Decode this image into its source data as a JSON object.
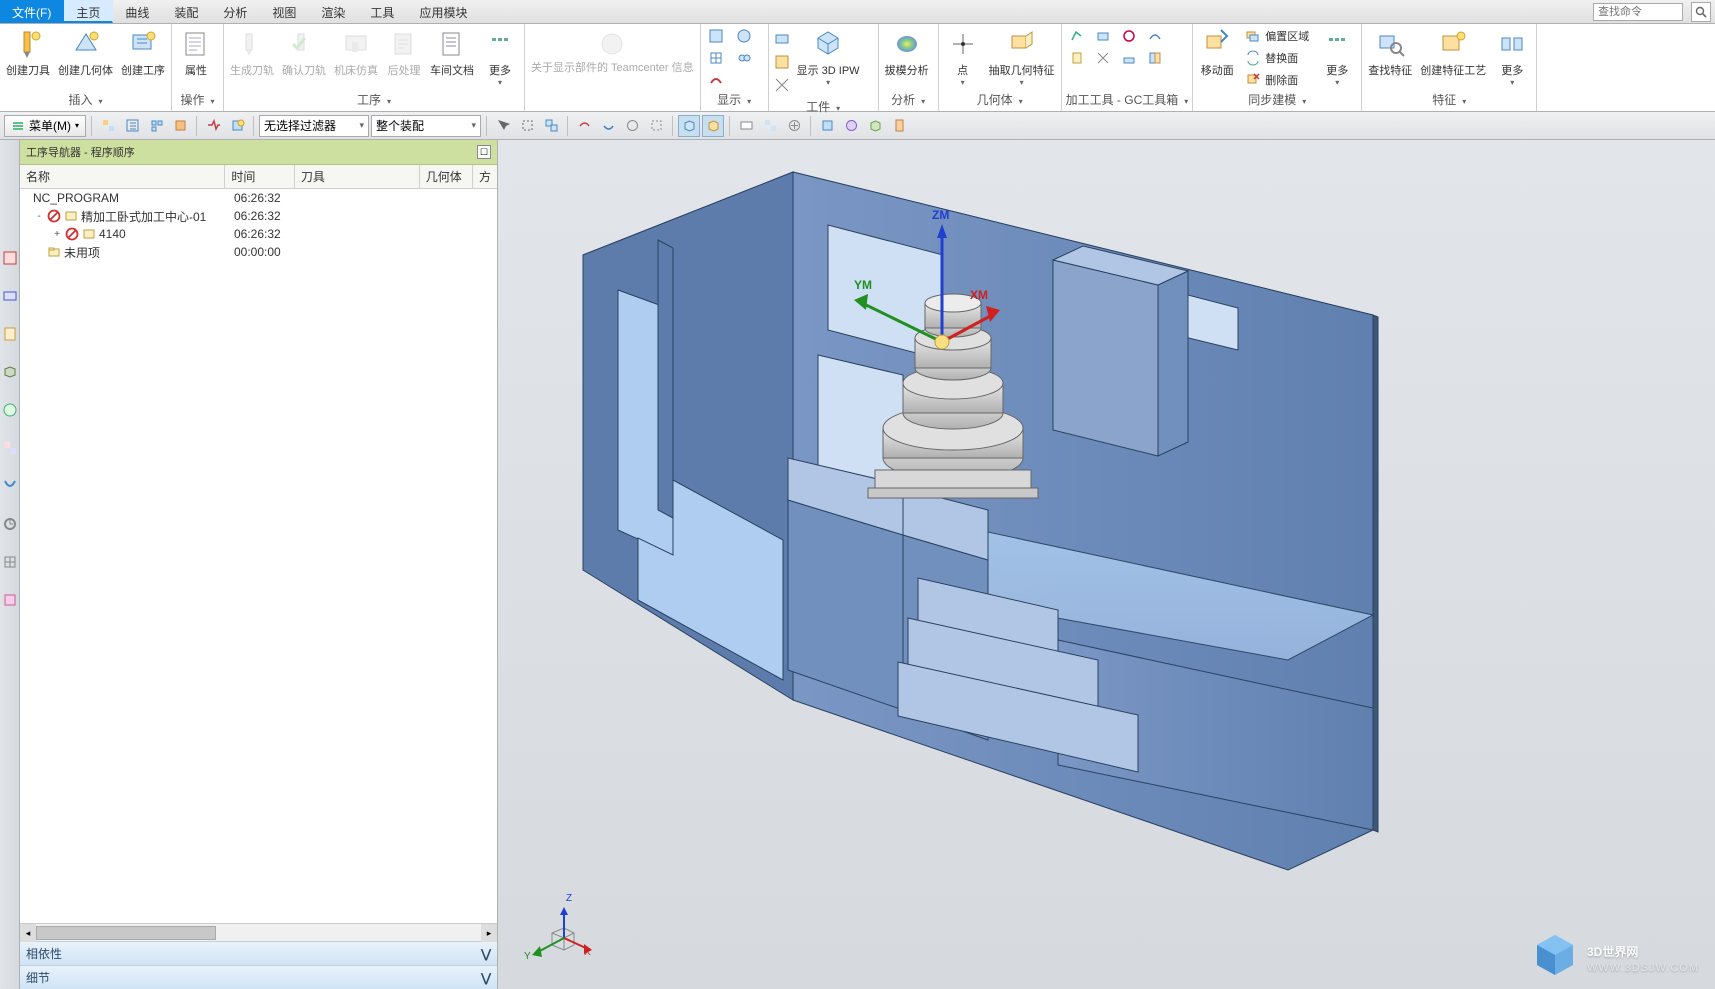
{
  "menubar": {
    "file": "文件(F)",
    "tabs": [
      "主页",
      "曲线",
      "装配",
      "分析",
      "视图",
      "渲染",
      "工具",
      "应用模块"
    ],
    "search_placeholder": "查找命令"
  },
  "ribbon": {
    "groups": {
      "insert": {
        "title": "插入",
        "items": [
          "创建刀具",
          "创建几何体",
          "创建工序"
        ]
      },
      "operation": {
        "title": "操作",
        "items": [
          "属性"
        ]
      },
      "process": {
        "title": "工序",
        "items": [
          "生成刀轨",
          "确认刀轨",
          "机床仿真",
          "后处理",
          "车间文档",
          "更多"
        ]
      },
      "tc": {
        "title": "",
        "items": [
          "关于显示部件的\nTeamcenter 信息"
        ]
      },
      "display": {
        "title": "显示"
      },
      "part": {
        "title": "工件",
        "items": [
          "显示 3D IPW"
        ]
      },
      "analysis": {
        "title": "分析",
        "items": [
          "拔模分析"
        ]
      },
      "geom": {
        "title": "几何体",
        "items": [
          "点",
          "抽取几何特征"
        ]
      },
      "gctools": {
        "title": "加工工具 - GC工具箱"
      },
      "sync": {
        "title": "同步建模",
        "items": [
          "移动面"
        ],
        "side": [
          "偏置区域",
          "替换面",
          "删除面"
        ],
        "more": "更多"
      },
      "feature": {
        "title": "特征",
        "items": [
          "查找特征",
          "创建特征工艺",
          "更多"
        ]
      }
    }
  },
  "quickbar": {
    "menu": "菜单(M)",
    "filter": "无选择过滤器",
    "assembly": "整个装配"
  },
  "navigator": {
    "title": "工序导航器 - 程序顺序",
    "columns": {
      "name": "名称",
      "time": "时间",
      "tool": "刀具",
      "geom": "几何体",
      "extra": "方"
    },
    "rows": [
      {
        "indent": 0,
        "name": "NC_PROGRAM",
        "time": "06:26:32",
        "icon": "prog"
      },
      {
        "indent": 1,
        "name": "精加工卧式加工中心-01",
        "time": "06:26:32",
        "icon": "forbid",
        "twist": "-"
      },
      {
        "indent": 2,
        "name": "4140",
        "time": "06:26:32",
        "icon": "forbid",
        "twist": "+"
      },
      {
        "indent": 1,
        "name": "未用项",
        "time": "00:00:00",
        "icon": "folder"
      }
    ],
    "panels": {
      "dependency": "相依性",
      "details": "细节"
    }
  },
  "viewport": {
    "axes": {
      "x": "XM",
      "y": "YM",
      "z": "ZM"
    },
    "triad": {
      "x": "X",
      "y": "Y",
      "z": "Z"
    }
  },
  "watermark": {
    "brand": "3D世界网",
    "url": "WWW.3DSJW.COM"
  }
}
